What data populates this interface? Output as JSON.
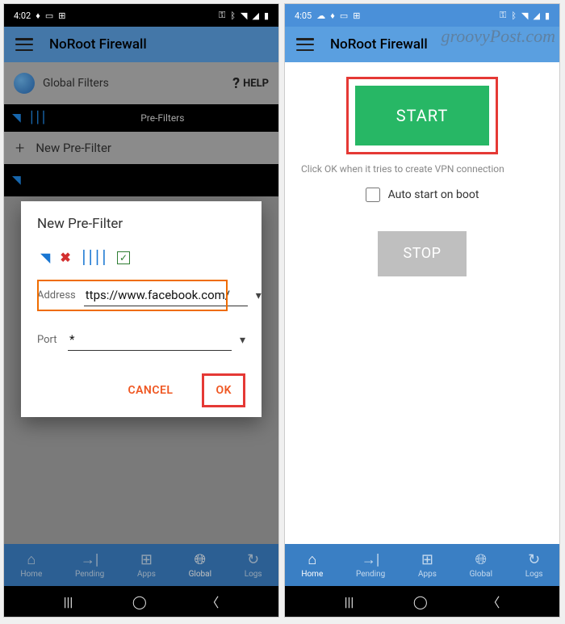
{
  "watermark": "groovyPost.com",
  "left": {
    "status": {
      "time": "4:02",
      "icons_left": [
        "fire-icon",
        "picture-icon",
        "grid-icon"
      ],
      "icons_right": [
        "key-icon",
        "bluetooth-icon",
        "wifi-icon",
        "signal-icon",
        "battery-icon"
      ]
    },
    "app_title": "NoRoot Firewall",
    "filters_section": "Global Filters",
    "help_label": "HELP",
    "prefilters_label": "Pre-Filters",
    "new_prefilter_label": "New Pre-Filter",
    "dialog": {
      "title": "New Pre-Filter",
      "address_label": "Address",
      "address_value": "ttps://www.facebook.com/",
      "port_label": "Port",
      "port_value": "*",
      "cancel_label": "CANCEL",
      "ok_label": "OK"
    },
    "nav": {
      "items": [
        {
          "label": "Home",
          "icon": "home-icon"
        },
        {
          "label": "Pending",
          "icon": "pending-icon"
        },
        {
          "label": "Apps",
          "icon": "apps-icon"
        },
        {
          "label": "Global",
          "icon": "globe-icon"
        },
        {
          "label": "Logs",
          "icon": "logs-icon"
        }
      ],
      "active_index": 3
    }
  },
  "right": {
    "status": {
      "time": "4:05",
      "icons_left": [
        "cloud-icon",
        "fire-icon",
        "picture-icon",
        "grid-icon"
      ],
      "icons_right": [
        "key-icon",
        "bluetooth-icon",
        "wifi-icon",
        "signal-icon",
        "battery-icon"
      ]
    },
    "app_title": "NoRoot Firewall",
    "start_label": "START",
    "hint": "Click OK when it tries to create VPN connection",
    "autostart_label": "Auto start on boot",
    "stop_label": "STOP",
    "nav": {
      "items": [
        {
          "label": "Home",
          "icon": "home-icon"
        },
        {
          "label": "Pending",
          "icon": "pending-icon"
        },
        {
          "label": "Apps",
          "icon": "apps-icon"
        },
        {
          "label": "Global",
          "icon": "globe-icon"
        },
        {
          "label": "Logs",
          "icon": "logs-icon"
        }
      ],
      "active_index": 0
    }
  },
  "colors": {
    "accent_blue": "#5a9fe0",
    "start_green": "#27b765",
    "highlight_red": "#e53935",
    "action_orange": "#ef5722"
  }
}
